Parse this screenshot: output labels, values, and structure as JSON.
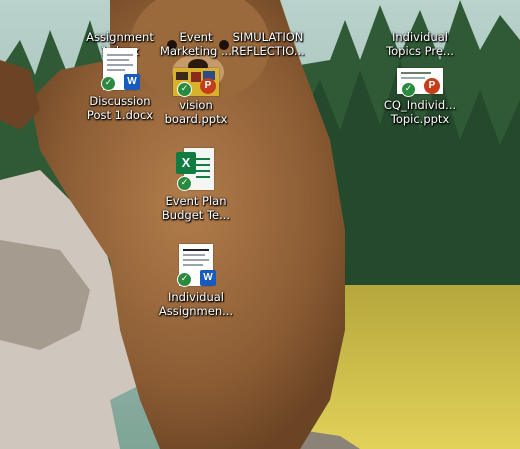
{
  "desktop": {
    "icons": [
      {
        "label": "Assignment 1.docx",
        "type": "word-doc"
      },
      {
        "label": "Event Marketing ...",
        "type": "powerpoint"
      },
      {
        "label": "SIMULATION REFLECTIO...",
        "type": "word-doc"
      },
      {
        "label": "Individual Topics Pre...",
        "type": "powerpoint"
      },
      {
        "label": "Discussion Post 1.docx",
        "type": "word-doc"
      },
      {
        "label": "vision board.pptx",
        "type": "powerpoint"
      },
      {
        "label": "CQ_Individ... Topic.pptx",
        "type": "powerpoint"
      },
      {
        "label": "Event Plan Budget Te...",
        "type": "excel"
      },
      {
        "label": "Individual Assignmen...",
        "type": "word-doc"
      }
    ],
    "sync_badge": "✓",
    "word_letter": "W",
    "ppt_letter": "P",
    "excel_letter": "X",
    "wallpaper": "brown bear cub in front of pine forest and meadow"
  }
}
